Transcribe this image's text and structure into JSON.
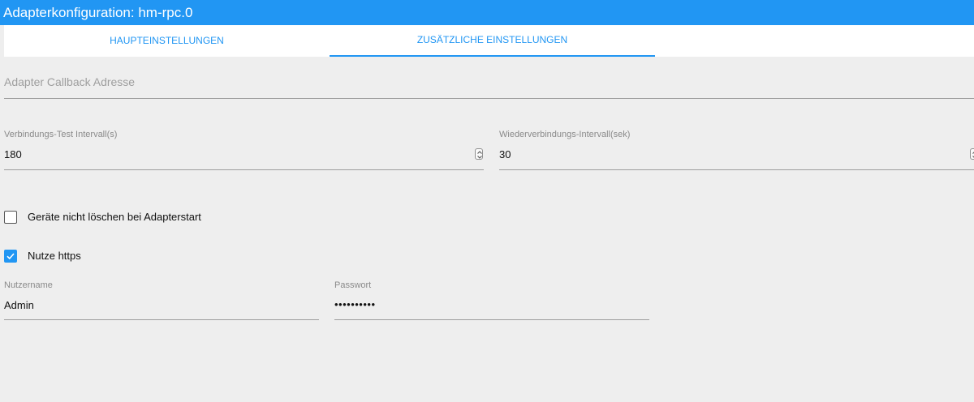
{
  "window": {
    "title": "Adapterkonfiguration: hm-rpc.0"
  },
  "tabs": [
    {
      "label": "HAUPTEINSTELLUNGEN"
    },
    {
      "label": "ZUSÄTZLICHE EINSTELLUNGEN"
    }
  ],
  "active_tab": "ZUSÄTZLICHE EINSTELLUNGEN",
  "callback": {
    "placeholder": "Adapter Callback Adresse",
    "value": ""
  },
  "connection_test": {
    "label": "Verbindungs-Test Intervall(s)",
    "value": "180"
  },
  "reconnect": {
    "label": "Wiederverbindungs-Intervall(sek)",
    "value": "30"
  },
  "dont_delete_devices": {
    "label": "Geräte nicht löschen bei Adapterstart",
    "checked": false
  },
  "use_https": {
    "label": "Nutze https",
    "checked": true
  },
  "username": {
    "label": "Nutzername",
    "value": "Admin"
  },
  "password": {
    "label": "Passwort",
    "value": "••••••••••"
  },
  "colors": {
    "accent": "#2196f3",
    "background": "#eeeeee",
    "tabbar": "#ffffff"
  },
  "icons": {
    "checkbox_checked": "check-icon",
    "spinner": "number-spinner-icon"
  }
}
